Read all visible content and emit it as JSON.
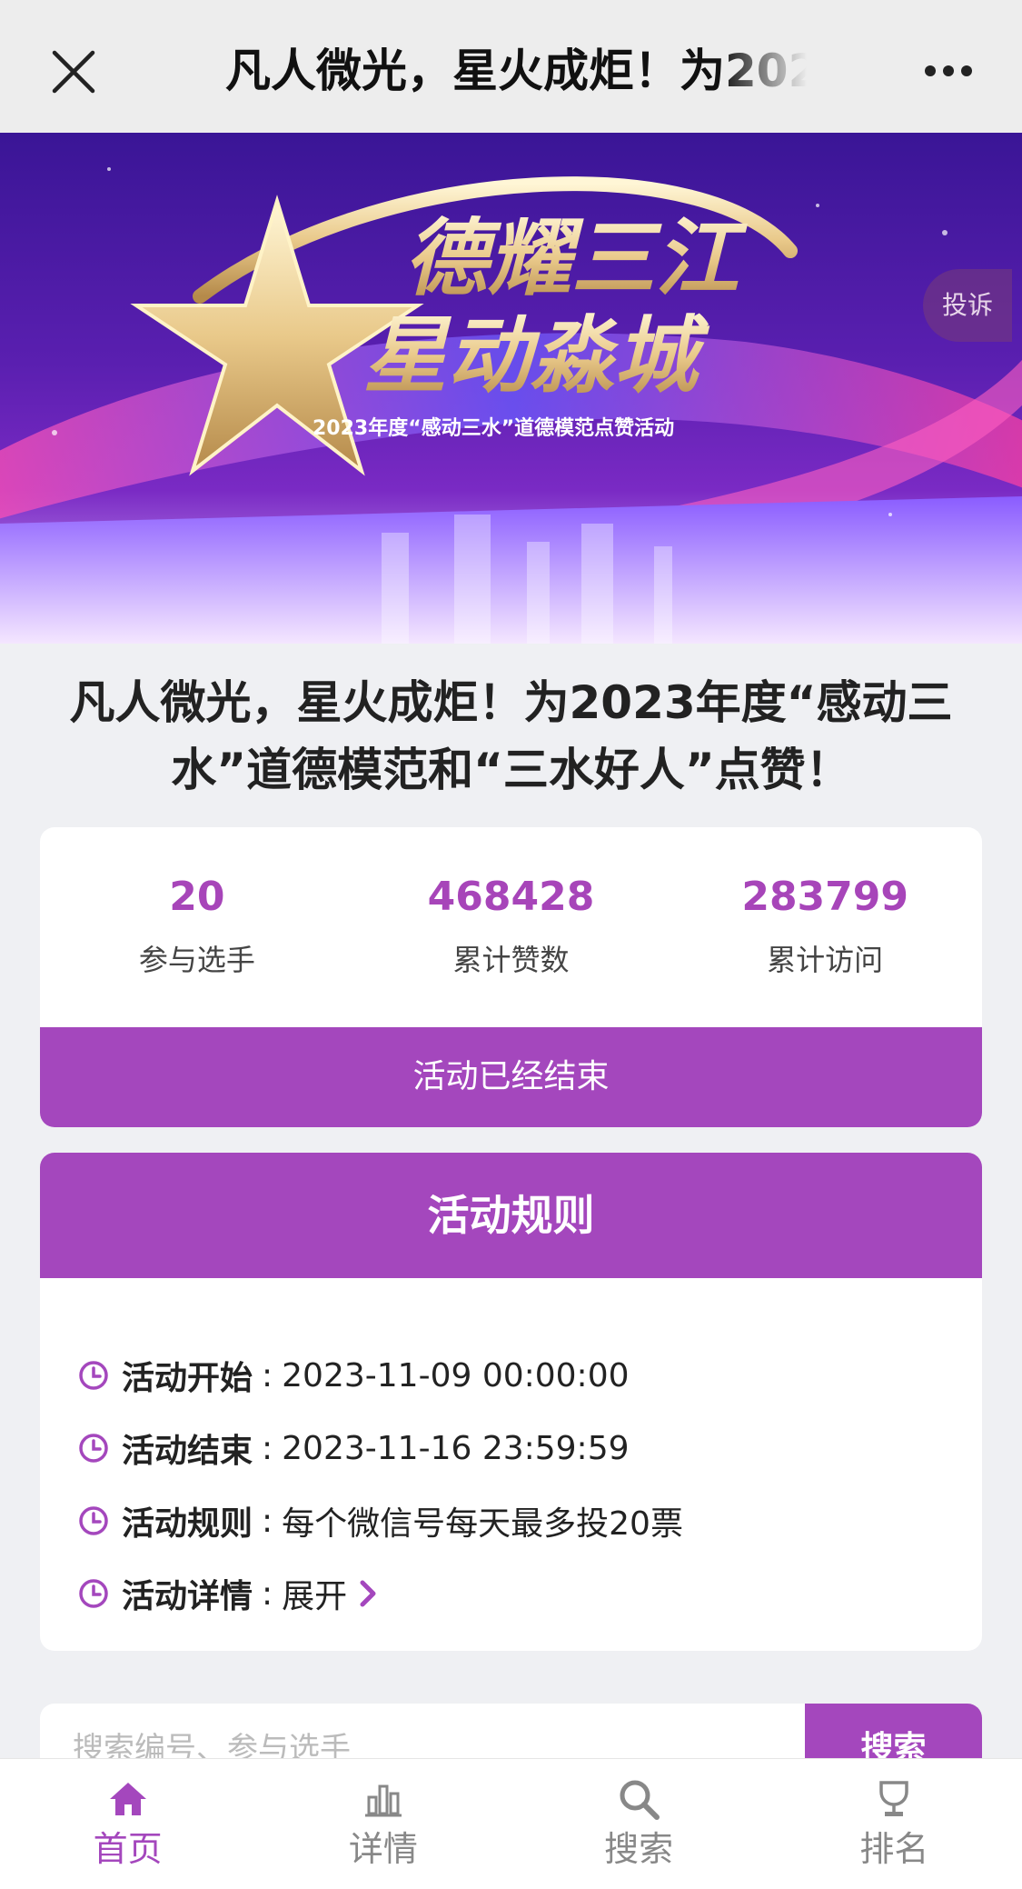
{
  "nav": {
    "title": "凡人微光，星火成炬！为202",
    "close_icon": "close-icon",
    "more_icon": "more-icon"
  },
  "banner": {
    "title_line1": "德耀三江",
    "title_line2": "星动淼城",
    "subtitle": "2023年度“感动三水”道德模范点赞活动",
    "complain_label": "投诉"
  },
  "headline": "凡人微光，星火成炬！为2023年度“感动三水”道德模范和“三水好人”点赞！",
  "stats": {
    "items": [
      {
        "value": "20",
        "label": "参与选手"
      },
      {
        "value": "468428",
        "label": "累计赞数"
      },
      {
        "value": "283799",
        "label": "累计访问"
      }
    ],
    "status": "活动已经结束"
  },
  "rules": {
    "heading": "活动规则",
    "items": [
      {
        "key": "活动开始",
        "value": "2023-11-09 00:00:00"
      },
      {
        "key": "活动结束",
        "value": "2023-11-16 23:59:59"
      },
      {
        "key": "活动规则",
        "value": "每个微信号每天最多投20票"
      },
      {
        "key": "活动详情",
        "value": "展开"
      }
    ]
  },
  "search": {
    "placeholder": "搜索编号、参与选手",
    "button_label": "搜索"
  },
  "tabbar": {
    "items": [
      {
        "label": "首页",
        "icon": "home-icon"
      },
      {
        "label": "详情",
        "icon": "chart-icon"
      },
      {
        "label": "搜索",
        "icon": "search-icon"
      },
      {
        "label": "排名",
        "icon": "ranking-icon"
      }
    ]
  },
  "colors": {
    "accent": "#a447bd",
    "stat_number": "#a745b9"
  }
}
